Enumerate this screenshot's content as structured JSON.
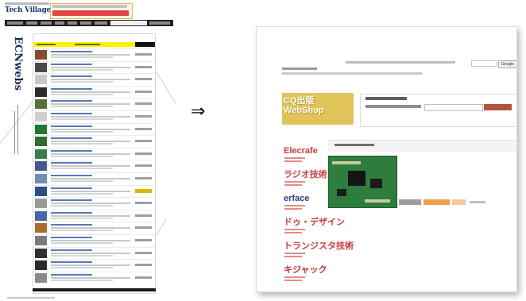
{
  "left_page": {
    "site_logo": "Tech Village",
    "ecn_logo": "ECNwebs",
    "product_rows": [
      {
        "thumb_color": "#8c4a2b"
      },
      {
        "thumb_color": "#4a4a4a"
      },
      {
        "thumb_color": "#c7c7c7"
      },
      {
        "thumb_color": "#2b2b2b"
      },
      {
        "thumb_color": "#5a6e3c"
      },
      {
        "thumb_color": "#d0d0d0"
      },
      {
        "thumb_color": "#1b7a2e"
      },
      {
        "thumb_color": "#2e6b2e"
      },
      {
        "thumb_color": "#3b7d43"
      },
      {
        "thumb_color": "#415a94"
      },
      {
        "thumb_color": "#6f8fb3"
      },
      {
        "thumb_color": "#2a4e8a",
        "price_highlight": true
      },
      {
        "thumb_color": "#9a9a9a"
      },
      {
        "thumb_color": "#4466aa"
      },
      {
        "thumb_color": "#ad6c2f"
      },
      {
        "thumb_color": "#7a7a7a"
      },
      {
        "thumb_color": "#303030"
      },
      {
        "thumb_color": "#2b2b2b"
      },
      {
        "thumb_color": "#8a8a8a"
      }
    ]
  },
  "arrow": "⇒",
  "shop": {
    "google_search": "Google",
    "banner_label": "CQ出版\nWebShop",
    "menu_items": [
      {
        "title": "Elecrafe",
        "color": "#d43a3a"
      },
      {
        "title": "ラジオ技術",
        "color": "#d43a3a"
      },
      {
        "title": "erface",
        "color": "#2b3f8c"
      },
      {
        "title": "ドゥ・デザイン",
        "color": "#d43a3a"
      },
      {
        "title": "トランジスタ技術",
        "color": "#d43a3a"
      },
      {
        "title": "キジャック",
        "color": "#c43030"
      }
    ]
  }
}
